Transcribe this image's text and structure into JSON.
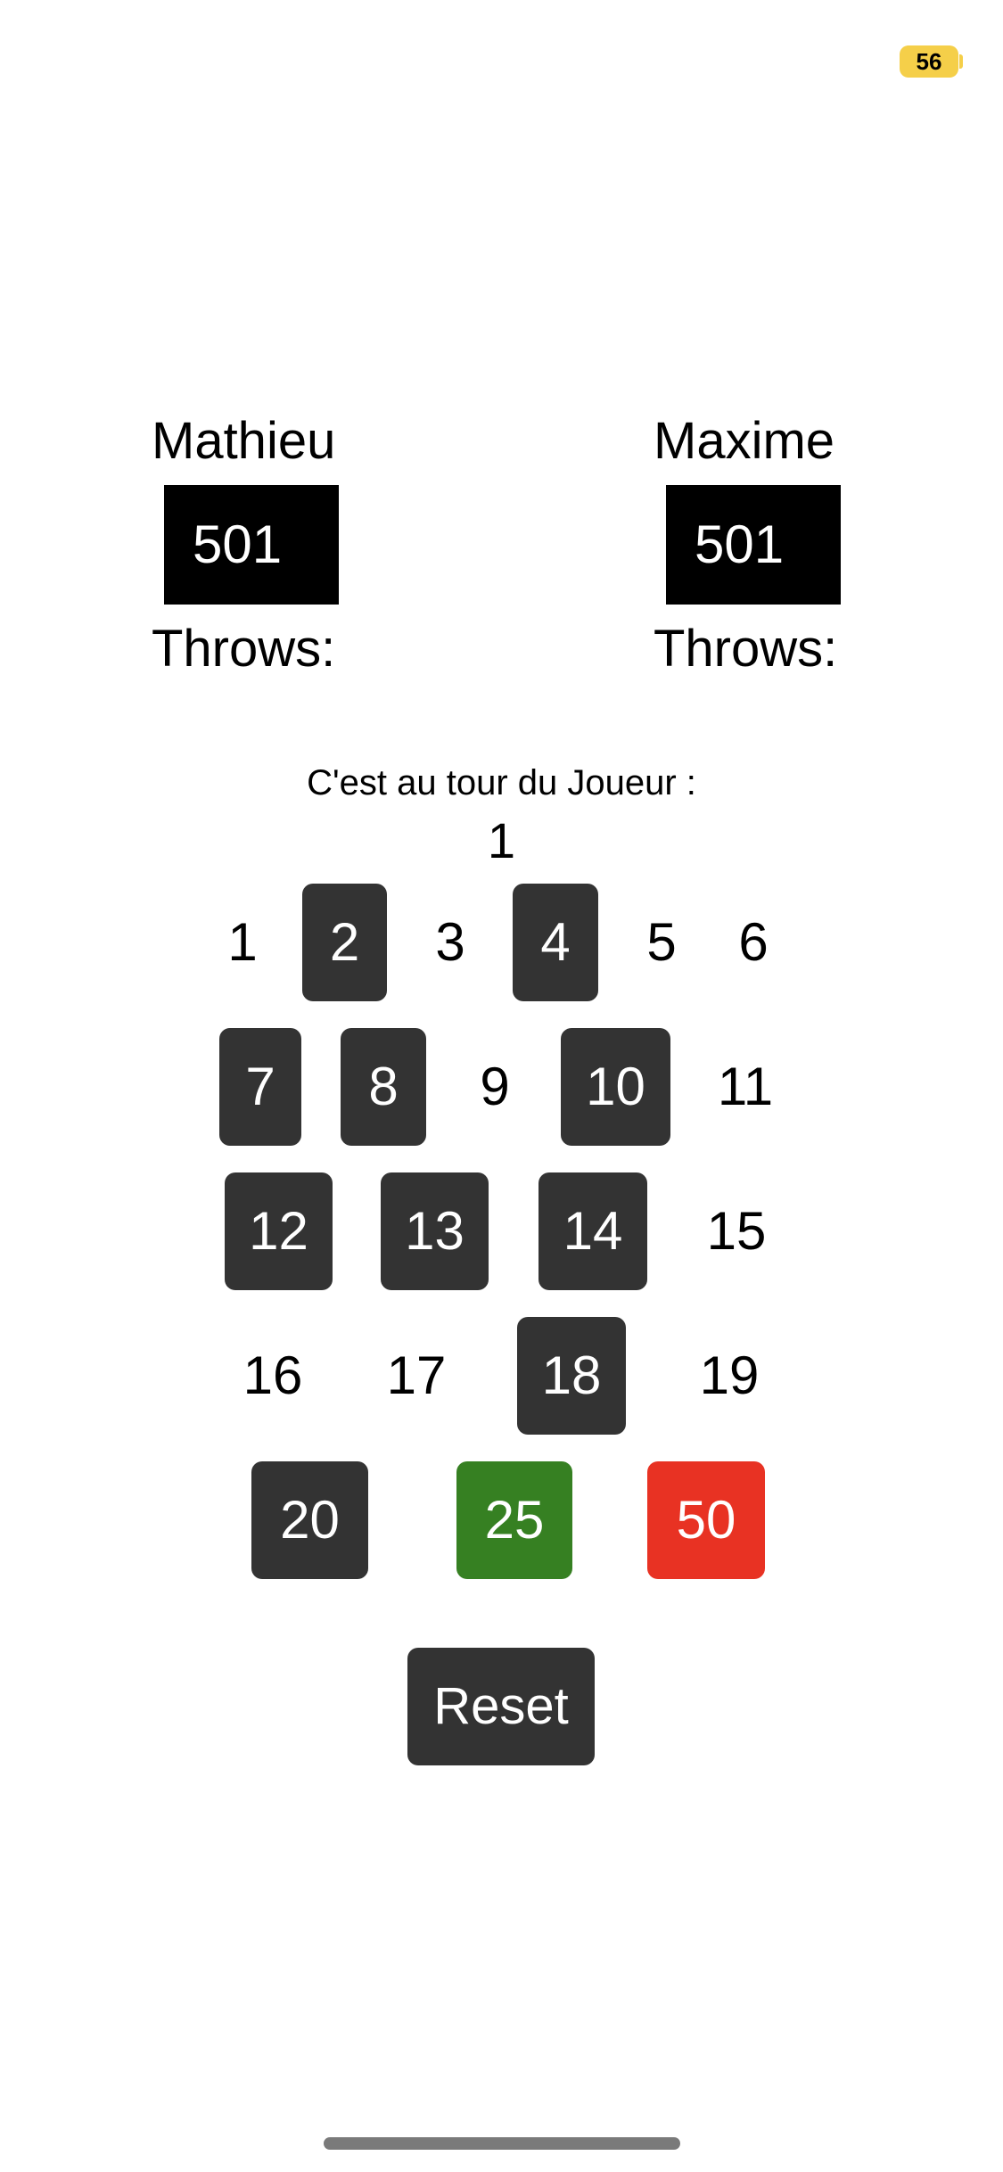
{
  "status_bar": {
    "battery_level": "56",
    "battery_color": "#f5cf49"
  },
  "players": [
    {
      "name": "Mathieu",
      "score": "501",
      "throws_label": "Throws:"
    },
    {
      "name": "Maxime",
      "score": "501",
      "throws_label": "Throws:"
    }
  ],
  "turn": {
    "label": "C'est au tour du Joueur :",
    "value": "1"
  },
  "board": {
    "row1": [
      "1",
      "2",
      "3",
      "4",
      "5",
      "6"
    ],
    "row2": [
      "7",
      "8",
      "9",
      "10",
      "11"
    ],
    "row3": [
      "12",
      "13",
      "14",
      "15"
    ],
    "row4": [
      "16",
      "17",
      "18",
      "19"
    ],
    "row5": [
      "20",
      "25",
      "50"
    ]
  },
  "reset_label": "Reset",
  "colors": {
    "button_dark": "#333333",
    "bull_25": "#368022",
    "bull_50": "#e83223"
  }
}
